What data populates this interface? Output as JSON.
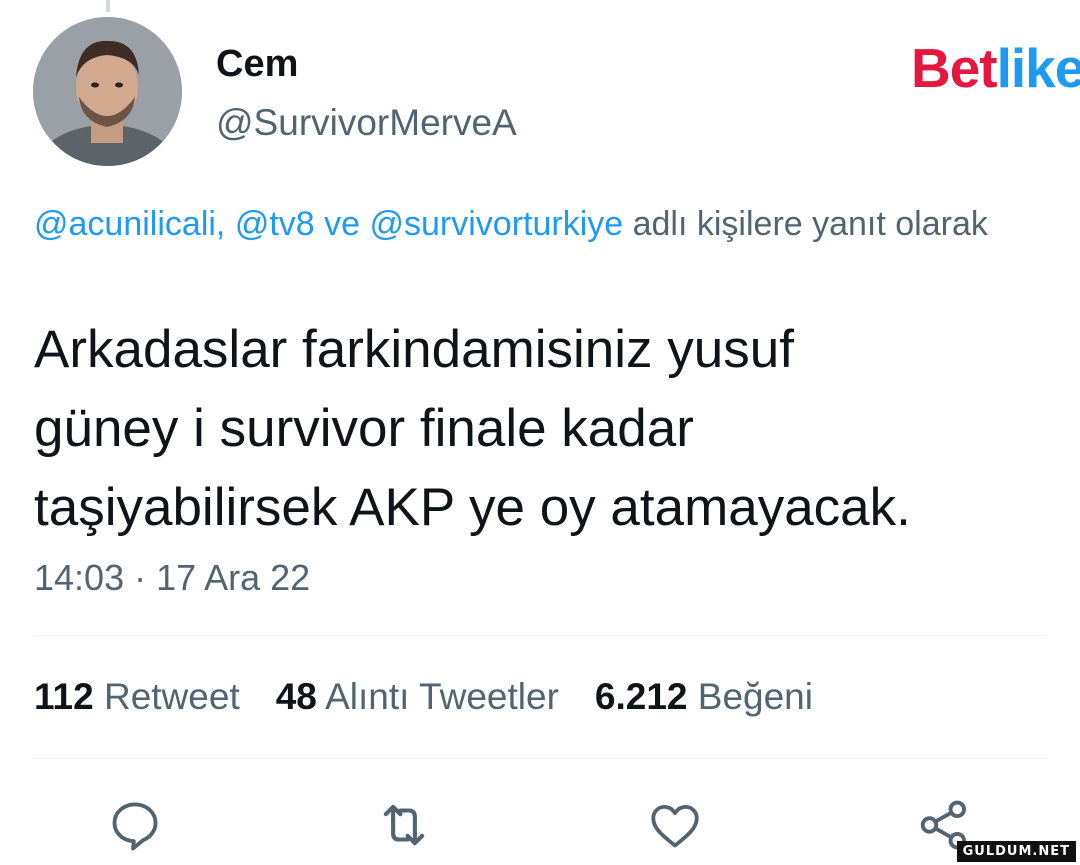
{
  "author": {
    "display_name": "Cem",
    "handle": "@SurvivorMerveA",
    "avatar": "avatar-photo"
  },
  "brand": {
    "logo_part1": "Bet",
    "logo_part2": "like",
    "color_primary": "#e5173f",
    "color_secondary": "#1d9bf0"
  },
  "reply_context": {
    "mentions": "@acunilicali, @tv8 ve @survivorturkiye",
    "suffix": " adlı kişilere yanıt olarak"
  },
  "tweet": {
    "text": "Arkadaslar farkindamisiniz yusuf\ngüney i survivor finale kadar\ntaşiyabilirsek AKP ye oy atamayacak.",
    "timestamp": "14:03 · 17 Ara 22"
  },
  "stats": [
    {
      "count": "112",
      "label": "Retweet"
    },
    {
      "count": "48",
      "label": "Alıntı Tweetler"
    },
    {
      "count": "6.212",
      "label": "Beğeni"
    }
  ],
  "actions": [
    {
      "icon": "reply-icon"
    },
    {
      "icon": "retweet-icon"
    },
    {
      "icon": "like-icon"
    },
    {
      "icon": "share-icon"
    }
  ],
  "colors": {
    "text": "#0f1419",
    "secondary": "#536471",
    "link": "#1d9bf0",
    "divider": "#eff3f4"
  },
  "watermark": "GULDUM.NET"
}
